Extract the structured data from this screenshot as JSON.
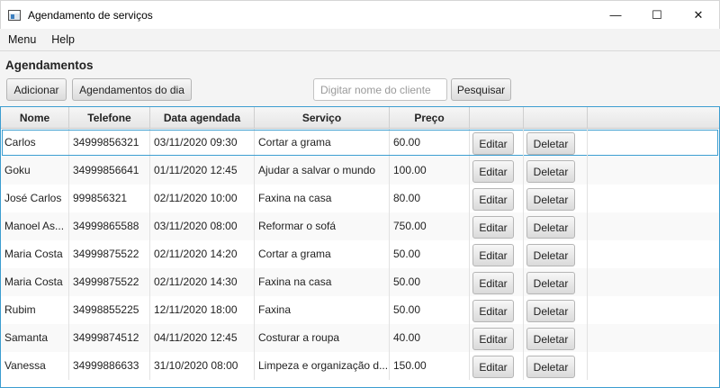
{
  "window": {
    "title": "Agendamento de serviços",
    "controls": {
      "minimize": "—",
      "maximize": "☐",
      "close": "✕"
    }
  },
  "menu": {
    "items": [
      {
        "label": "Menu"
      },
      {
        "label": "Help"
      }
    ]
  },
  "toolbar": {
    "section_title": "Agendamentos",
    "add_label": "Adicionar",
    "today_label": "Agendamentos do dia",
    "search_placeholder": "Digitar nome do cliente",
    "search_value": "",
    "search_label": "Pesquisar"
  },
  "table": {
    "headers": {
      "nome": "Nome",
      "telefone": "Telefone",
      "data": "Data agendada",
      "servico": "Serviço",
      "preco": "Preço"
    },
    "edit_label": "Editar",
    "delete_label": "Deletar",
    "rows": [
      {
        "nome": "Carlos",
        "telefone": "34999856321",
        "data": "03/11/2020 09:30",
        "servico": "Cortar a grama",
        "preco": "60.00"
      },
      {
        "nome": "Goku",
        "telefone": "34999856641",
        "data": "01/11/2020 12:45",
        "servico": "Ajudar a salvar o mundo",
        "preco": "100.00"
      },
      {
        "nome": "José Carlos",
        "telefone": "999856321",
        "data": "02/11/2020 10:00",
        "servico": "Faxina na casa",
        "preco": "80.00"
      },
      {
        "nome": "Manoel As...",
        "telefone": "34999865588",
        "data": "03/11/2020 08:00",
        "servico": "Reformar o sofá",
        "preco": "750.00"
      },
      {
        "nome": "Maria Costa",
        "telefone": "34999875522",
        "data": "02/11/2020 14:20",
        "servico": "Cortar a grama",
        "preco": "50.00"
      },
      {
        "nome": "Maria Costa",
        "telefone": "34999875522",
        "data": "02/11/2020 14:30",
        "servico": "Faxina na casa",
        "preco": "50.00"
      },
      {
        "nome": "Rubim",
        "telefone": "34998855225",
        "data": "12/11/2020 18:00",
        "servico": "Faxina",
        "preco": "50.00"
      },
      {
        "nome": "Samanta",
        "telefone": "34999874512",
        "data": "04/11/2020 12:45",
        "servico": "Costurar a roupa",
        "preco": "40.00"
      },
      {
        "nome": "Vanessa",
        "telefone": "34999886633",
        "data": "31/10/2020 08:00",
        "servico": "Limpeza e organização d...",
        "preco": "150.00"
      }
    ]
  }
}
